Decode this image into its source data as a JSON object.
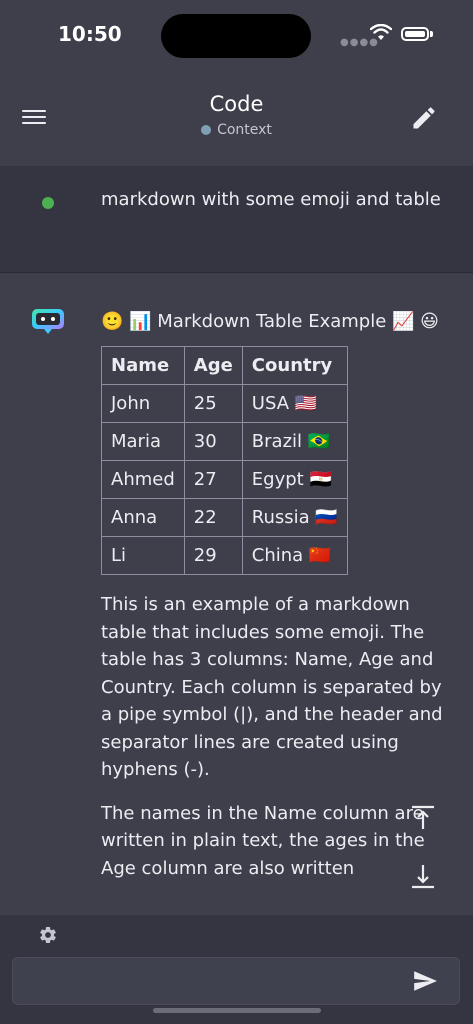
{
  "status_bar": {
    "time": "10:50"
  },
  "header": {
    "title": "Code",
    "subtitle": "Context"
  },
  "user_message": {
    "text": "markdown with some emoji and table"
  },
  "bot_message": {
    "heading": "🙂 📊 Markdown Table Example 📈 😃",
    "table": {
      "columns": [
        "Name",
        "Age",
        "Country"
      ],
      "rows": [
        [
          "John",
          "25",
          "USA 🇺🇸"
        ],
        [
          "Maria",
          "30",
          "Brazil 🇧🇷"
        ],
        [
          "Ahmed",
          "27",
          "Egypt 🇪🇬"
        ],
        [
          "Anna",
          "22",
          "Russia 🇷🇺"
        ],
        [
          "Li",
          "29",
          "China 🇨🇳"
        ]
      ]
    },
    "paragraphs": [
      "This is an example of a markdown table that includes some emoji. The table has 3 columns: Name, Age and Country. Each column is separated by a pipe symbol (|), and the header and separator lines are created using hyphens (-).",
      "The names in the Name column are written in plain text, the ages in the Age column are also written"
    ]
  },
  "composer": {
    "placeholder": ""
  },
  "colors": {
    "background": "#3e3f4b",
    "user_bg": "#343541",
    "user_dot": "#4caf50",
    "context_dot": "#7f9fb2"
  },
  "icons": {
    "menu": "hamburger-icon",
    "edit": "pencil-icon",
    "bot": "robot-icon",
    "scroll_top": "arrow-to-top-icon",
    "scroll_bottom": "arrow-to-bottom-icon",
    "settings": "gear-icon",
    "send": "send-icon"
  }
}
